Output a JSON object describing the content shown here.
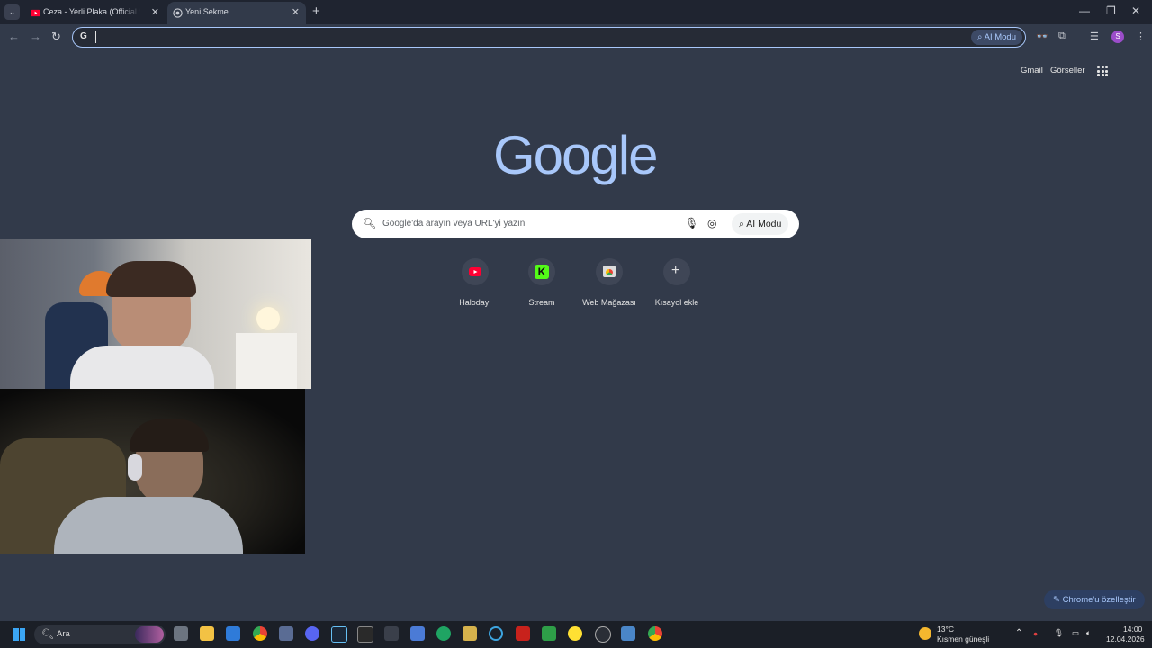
{
  "tabs": [
    {
      "title": "Ceza - Yerli Plaka (Official Video)"
    },
    {
      "title": "Yeni Sekme"
    }
  ],
  "omnibox": {
    "ai_label": "AI Modu",
    "value": ""
  },
  "top_links": {
    "gmail": "Gmail",
    "images": "Görseller"
  },
  "logo": "Google",
  "search": {
    "placeholder": "Google'da arayın veya URL'yi yazın",
    "ai_label": "AI Modu"
  },
  "shortcuts": [
    {
      "label": "Halodayı"
    },
    {
      "label": "Stream"
    },
    {
      "label": "Web Mağazası"
    },
    {
      "label": "Kısayol ekle"
    }
  ],
  "customize_label": "Chrome'u özelleştir",
  "profile_initial": "S",
  "taskbar": {
    "search_label": "Ara",
    "weather_temp": "13°C",
    "weather_desc": "Kısmen güneşli",
    "time": "14:00",
    "date": "12.04.2026"
  },
  "colors": {
    "accent": "#a8c7fa",
    "page_bg": "#323a4a",
    "tabstrip": "#1f2430"
  }
}
